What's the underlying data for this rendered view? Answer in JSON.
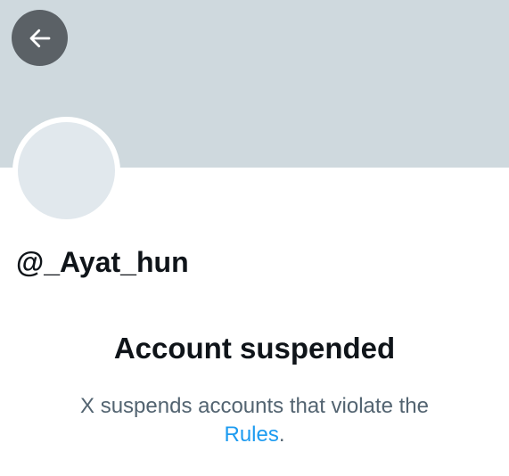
{
  "header": {
    "back_icon": "arrow-left-icon"
  },
  "profile": {
    "handle": "@_Ayat_hun"
  },
  "notice": {
    "title": "Account suspended",
    "message_prefix": "X suspends accounts that violate the",
    "link_label": "Rules",
    "message_suffix": "."
  },
  "colors": {
    "banner": "#cfd9de",
    "back_button_bg": "#5b6166",
    "avatar": "#e1e8ed",
    "text_primary": "#0f1419",
    "text_secondary": "#536471",
    "link": "#1d9bf0"
  }
}
